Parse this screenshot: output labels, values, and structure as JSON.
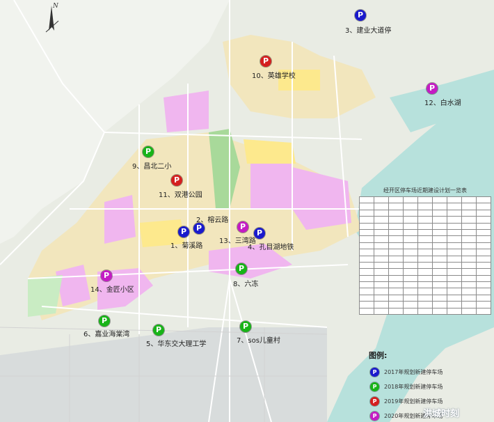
{
  "map": {
    "colors": {
      "p2017": "#1a1acc",
      "p2018": "#18b418",
      "p2019": "#d41f1f",
      "p2020": "#c41cc4"
    },
    "markers": [
      {
        "id": "m1",
        "label": "1、菊溪路",
        "year": "p2017"
      },
      {
        "id": "m2",
        "label": "2、榕云路",
        "year": "p2017"
      },
      {
        "id": "m3",
        "label": "3、建业大道停",
        "year": "p2017"
      },
      {
        "id": "m4",
        "label": "4、孔目湖地铁",
        "year": "p2017"
      },
      {
        "id": "m5",
        "label": "5、华东交大理工学",
        "year": "p2018"
      },
      {
        "id": "m6",
        "label": "6、嘉业海棠湾",
        "year": "p2018"
      },
      {
        "id": "m7",
        "label": "7、sos儿童村",
        "year": "p2018"
      },
      {
        "id": "m8",
        "label": "8、六冻",
        "year": "p2018"
      },
      {
        "id": "m9",
        "label": "9、昌北二小",
        "year": "p2018"
      },
      {
        "id": "m10",
        "label": "10、英雄学校",
        "year": "p2019"
      },
      {
        "id": "m11",
        "label": "11、双港公园",
        "year": "p2019"
      },
      {
        "id": "m12",
        "label": "12、白水湖",
        "year": "p2020"
      },
      {
        "id": "m13",
        "label": "13、三湾路",
        "year": "p2020"
      },
      {
        "id": "m14",
        "label": "14、金匠小区",
        "year": "p2020"
      }
    ],
    "marker_glyph": "P",
    "north_glyph": "N",
    "table_title": "经开区停车场近期建设计划一览表",
    "legend": {
      "title": "图例:",
      "items": [
        {
          "year": "p2017",
          "text": "2017年规划新建停车场"
        },
        {
          "year": "p2018",
          "text": "2018年规划新建停车场"
        },
        {
          "year": "p2019",
          "text": "2019年规划新建停车场"
        },
        {
          "year": "p2020",
          "text": "2020年规划新建停车场"
        }
      ]
    },
    "watermark": "洪城时刻"
  }
}
